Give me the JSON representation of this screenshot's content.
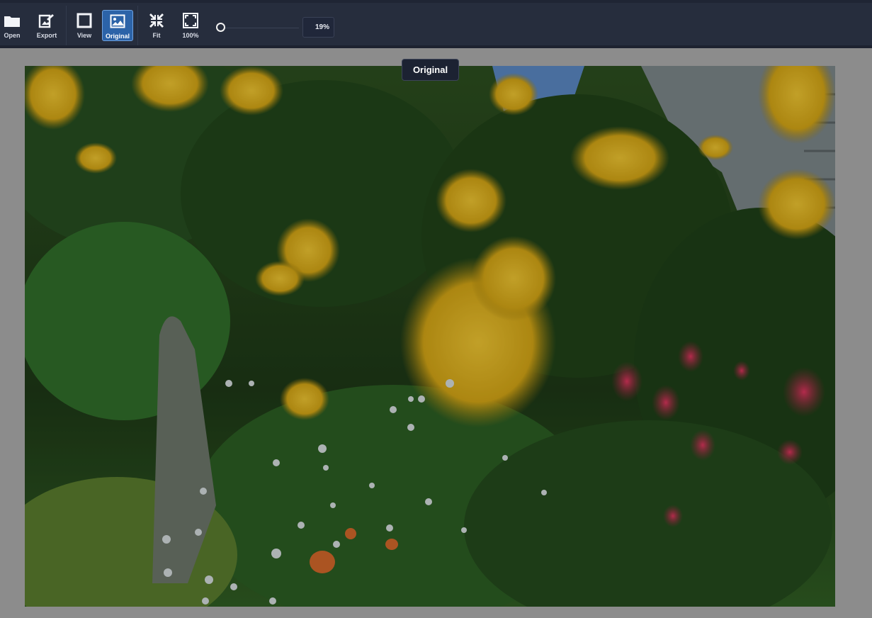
{
  "toolbar": {
    "open_label": "Open",
    "export_label": "Export",
    "view_label": "View",
    "original_label": "Original",
    "fit_label": "Fit",
    "actual_size_label": "100%",
    "zoom_value": "19%",
    "zoom_level": 0.19
  },
  "tooltip": {
    "text": "Original"
  },
  "colors": {
    "toolbar_bg": "#262d3d",
    "active_button": "#2c63a8",
    "workspace_bg": "#8c8c8c",
    "tooltip_bg": "#1c2232"
  },
  "icons": {
    "open": "folder-icon",
    "export": "export-icon",
    "view": "square-icon",
    "original": "image-icon",
    "fit": "compress-icon",
    "actual_size": "expand-icon"
  }
}
